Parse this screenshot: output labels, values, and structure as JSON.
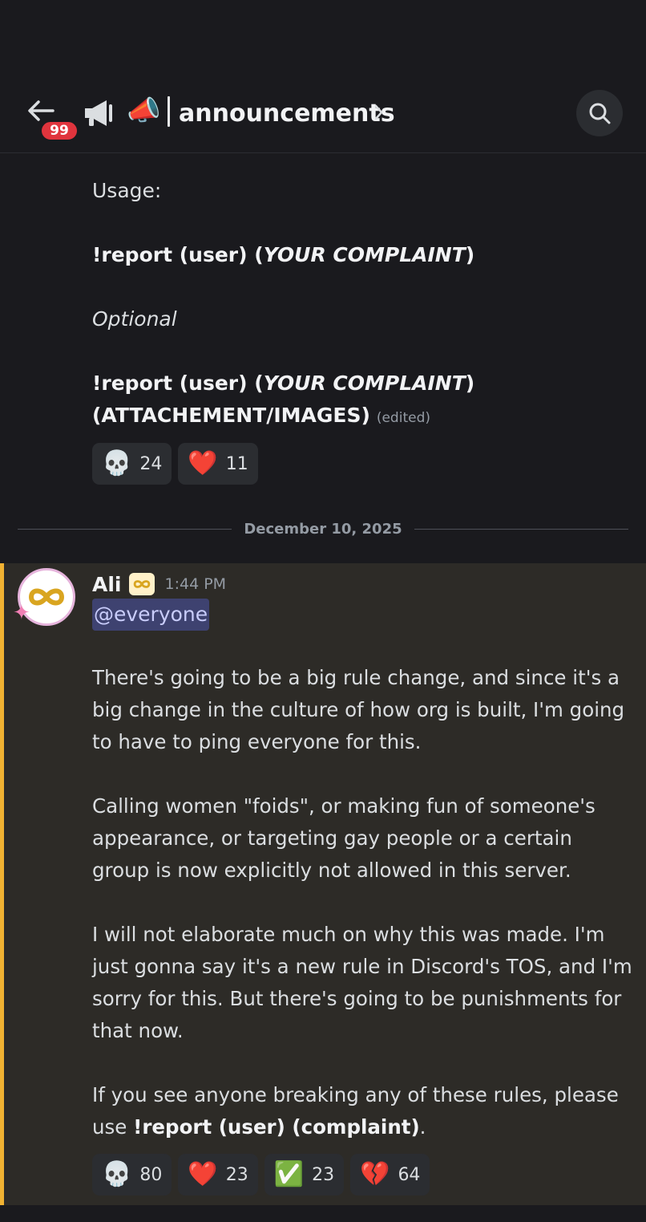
{
  "header": {
    "badge_count": "99",
    "megaphone_emoji": "📣",
    "channel_name": "announcements"
  },
  "previous_message": {
    "usage_label": "Usage:",
    "command1_prefix": "!report (user) (",
    "command1_italic": "YOUR COMPLAINT",
    "command1_suffix": ")",
    "optional_label": "Optional",
    "command2_prefix": "!report (user) (",
    "command2_italic": "YOUR COMPLAINT",
    "command2_suffix": ")",
    "command2_line2": "(ATTACHEMENT/IMAGES)",
    "edited_label": "(edited)",
    "reactions": [
      {
        "emoji": "💀",
        "count": "24"
      },
      {
        "emoji": "❤️",
        "count": "11"
      }
    ]
  },
  "date_divider": "December 10, 2025",
  "message": {
    "author": "Ali",
    "timestamp": "1:44 PM",
    "mention": "@everyone",
    "paragraph1": "There's going to be a big rule change, and since it's a big change in the culture of how org is built, I'm going to have to ping everyone for this.",
    "paragraph2": "Calling women \"foids\", or making fun of someone's appearance, or targeting gay people or a certain group is now explicitly not allowed in this server.",
    "paragraph3": "I will not elaborate much on why this was made. I'm just gonna say it's a new rule in Discord's TOS, and I'm sorry for this. But there's going to be punishments for that now.",
    "paragraph4_prefix": "If you see anyone breaking any of these rules, please use ",
    "paragraph4_bold": "!report (user) (complaint)",
    "paragraph4_suffix": ".",
    "reactions": [
      {
        "emoji": "💀",
        "count": "80"
      },
      {
        "emoji": "❤️",
        "count": "23"
      },
      {
        "emoji": "✅",
        "count": "23"
      },
      {
        "emoji": "💔",
        "count": "64"
      }
    ]
  },
  "colors": {
    "background": "#1a1a1e",
    "mention_highlight": "#2d2b27",
    "mention_bar": "#f0b232",
    "badge": "#e0343d",
    "mention_pill": "#3e4270"
  }
}
